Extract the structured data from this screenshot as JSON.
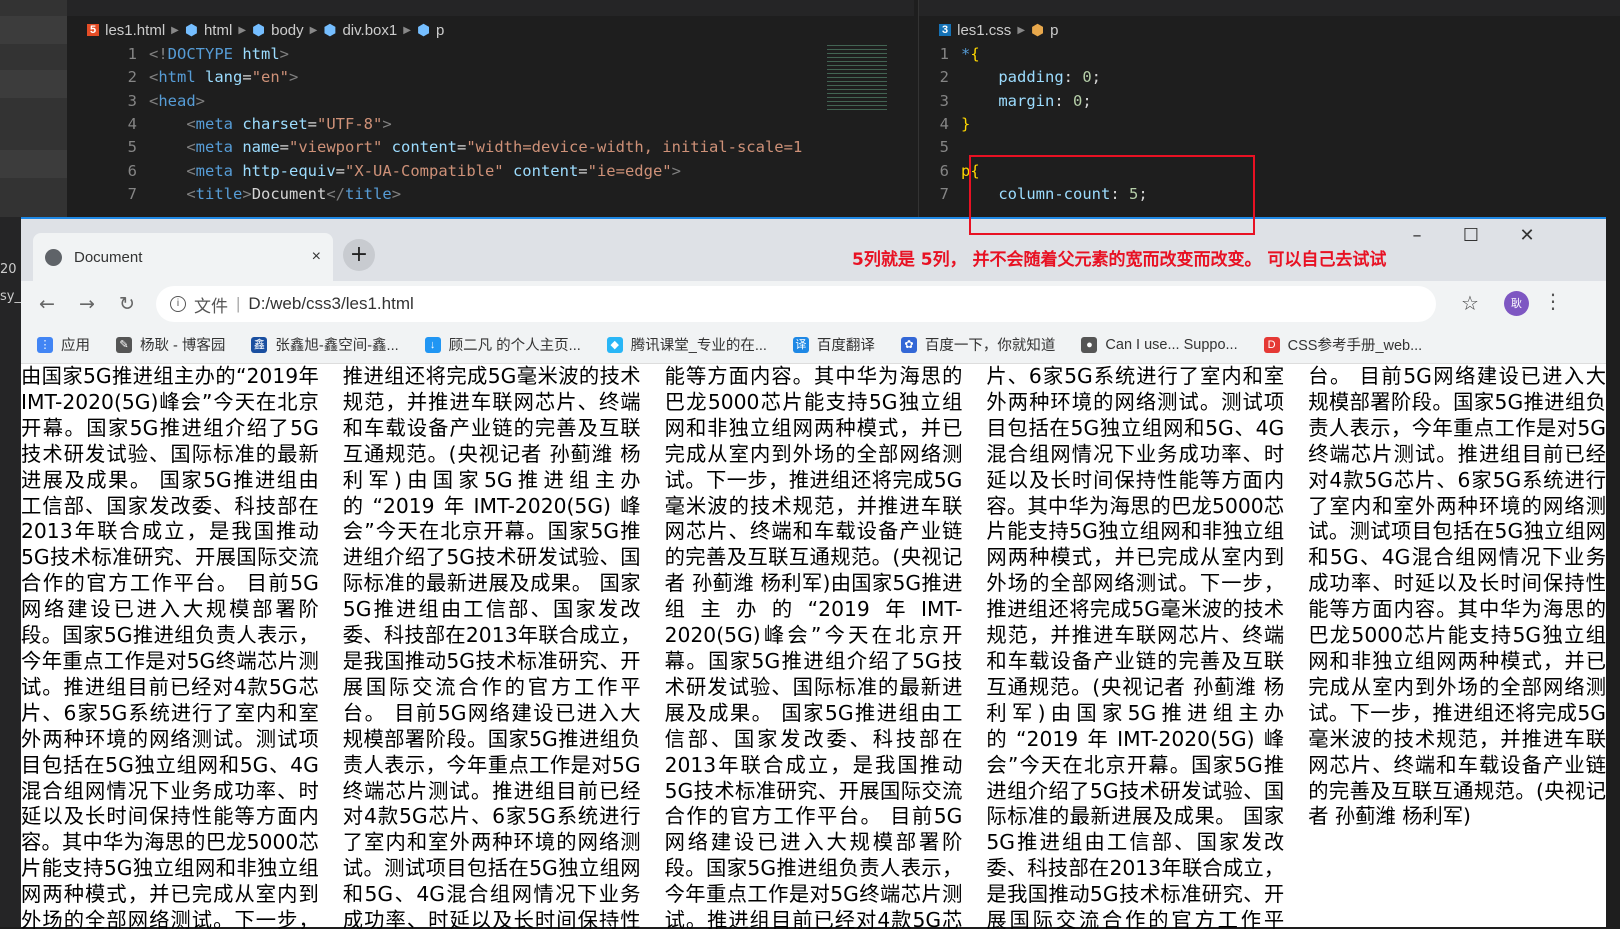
{
  "editor_left": {
    "breadcrumb": [
      "les1.html",
      "html",
      "body",
      "div.box1",
      "p"
    ],
    "lines": [
      {
        "n": "1",
        "parts": [
          [
            "g",
            "<!"
          ],
          [
            "t",
            "DOCTYPE"
          ],
          [
            "",
            ""
          ],
          [
            "a",
            " html"
          ],
          [
            "g",
            ">"
          ]
        ]
      },
      {
        "n": "2",
        "parts": [
          [
            "g",
            "<"
          ],
          [
            "t",
            "html"
          ],
          [
            "a",
            " lang"
          ],
          [
            "",
            "="
          ],
          [
            "s",
            "\"en\""
          ],
          [
            "g",
            ">"
          ]
        ]
      },
      {
        "n": "3",
        "parts": [
          [
            "g",
            "<"
          ],
          [
            "t",
            "head"
          ],
          [
            "g",
            ">"
          ]
        ]
      },
      {
        "n": "4",
        "parts": [
          [
            "",
            ""
          ],
          [
            "g",
            "    <"
          ],
          [
            "t",
            "meta"
          ],
          [
            "a",
            " charset"
          ],
          [
            "",
            "="
          ],
          [
            "s",
            "\"UTF-8\""
          ],
          [
            "g",
            ">"
          ]
        ]
      },
      {
        "n": "5",
        "parts": [
          [
            "g",
            "    <"
          ],
          [
            "t",
            "meta"
          ],
          [
            "a",
            " name"
          ],
          [
            "",
            "="
          ],
          [
            "s",
            "\"viewport\""
          ],
          [
            "a",
            " content"
          ],
          [
            "",
            "="
          ],
          [
            "s",
            "\"width=device-width, initial-scale=1"
          ]
        ]
      },
      {
        "n": "6",
        "parts": [
          [
            "g",
            "    <"
          ],
          [
            "t",
            "meta"
          ],
          [
            "a",
            " http-equiv"
          ],
          [
            "",
            "="
          ],
          [
            "s",
            "\"X-UA-Compatible\""
          ],
          [
            "a",
            " content"
          ],
          [
            "",
            "="
          ],
          [
            "s",
            "\"ie=edge\""
          ],
          [
            "g",
            ">"
          ]
        ]
      },
      {
        "n": "7",
        "parts": [
          [
            "g",
            "    <"
          ],
          [
            "t",
            "title"
          ],
          [
            "g",
            ">"
          ],
          [
            "",
            "Document"
          ],
          [
            "g",
            "</"
          ],
          [
            "t",
            "title"
          ],
          [
            "g",
            ">"
          ]
        ]
      }
    ]
  },
  "editor_right": {
    "breadcrumb": [
      "les1.css",
      "p"
    ],
    "lines": [
      {
        "n": "1",
        "parts": [
          [
            "t",
            "*"
          ],
          [
            "y",
            "{"
          ]
        ]
      },
      {
        "n": "2",
        "parts": [
          [
            "a",
            "    padding"
          ],
          [
            "",
            ": "
          ],
          [
            "n",
            "0"
          ],
          [
            "",
            ";"
          ]
        ]
      },
      {
        "n": "3",
        "parts": [
          [
            "a",
            "    margin"
          ],
          [
            "",
            ": "
          ],
          [
            "n",
            "0"
          ],
          [
            "",
            ";"
          ]
        ]
      },
      {
        "n": "4",
        "parts": [
          [
            "y",
            "}"
          ]
        ]
      },
      {
        "n": "5",
        "parts": []
      },
      {
        "n": "6",
        "parts": [
          [
            "y",
            "p"
          ],
          [
            "y",
            "{"
          ]
        ]
      },
      {
        "n": "7",
        "parts": [
          [
            "a",
            "    column-count"
          ],
          [
            "",
            ": "
          ],
          [
            "n",
            "5"
          ],
          [
            "",
            ";"
          ]
        ]
      }
    ]
  },
  "left_strip": [
    "20",
    "sy_"
  ],
  "browser": {
    "tab_title": "Document",
    "tab_close": "×",
    "new_tab": "+",
    "annotation": "5列就是 5列， 并不会随着父元素的宽而改变而改变。 可以自己去试试",
    "address_label": "文件",
    "address_sep": "|",
    "url": "D:/web/css3/les1.html",
    "avatar": "耿",
    "bookmarks": [
      {
        "label": "应用",
        "color": "#4285f4",
        "glyph": "⋮"
      },
      {
        "label": "杨耿 - 博客园",
        "color": "#555",
        "glyph": "✎"
      },
      {
        "label": "张鑫旭-鑫空间-鑫...",
        "color": "#1a4fa0",
        "glyph": "鑫"
      },
      {
        "label": "顾二凡 的个人主页...",
        "color": "#2196f3",
        "glyph": "↓"
      },
      {
        "label": "腾讯课堂_专业的在...",
        "color": "#29b6f6",
        "glyph": "◆"
      },
      {
        "label": "百度翻译",
        "color": "#1e88e5",
        "glyph": "译"
      },
      {
        "label": "百度一下，你就知道",
        "color": "#3367d6",
        "glyph": "✿"
      },
      {
        "label": "Can I use... Suppo...",
        "color": "#555",
        "glyph": "●"
      },
      {
        "label": "CSS参考手册_web...",
        "color": "#e53935",
        "glyph": "D"
      }
    ],
    "paragraph": "由国家5G推进组主办的“2019年IMT-2020(5G)峰会”今天在北京开幕。国家5G推进组介绍了5G技术研发试验、国际标准的最新进展及成果。 国家5G推进组由工信部、国家发改委、科技部在2013年联合成立，是我国推动5G技术标准研究、开展国际交流合作的官方工作平台。 目前5G网络建设已进入大规模部署阶段。国家5G推进组负责人表示，今年重点工作是对5G终端芯片测试。推进组目前已经对4款5G芯片、6家5G系统进行了室内和室外两种环境的网络测试。测试项目包括在5G独立组网和5G、4G混合组网情况下业务成功率、时延以及长时间保持性能等方面内容。其中华为海思的巴龙5000芯片能支持5G独立组网和非独立组网两种模式，并已完成从室内到外场的全部网络测试。下一步，推进组还将完成5G毫米波的技术规范，并推进车联网芯片、终端和车载设备产业链的完善及互联互通规范。(央视记者 孙蓟潍 杨利军)",
    "paragraph_repeat": 4
  }
}
